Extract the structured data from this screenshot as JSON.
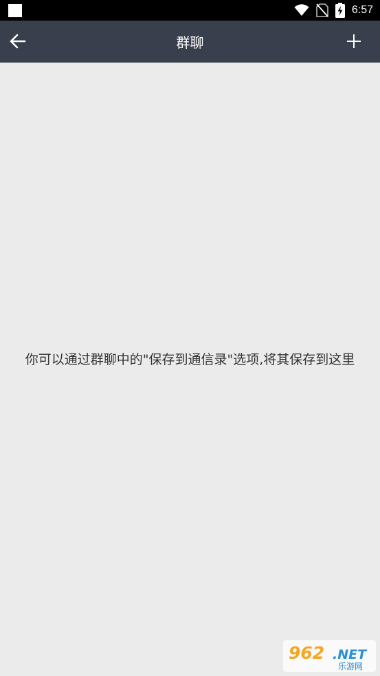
{
  "status_bar": {
    "time": "6:57"
  },
  "app_bar": {
    "title": "群聊"
  },
  "main": {
    "empty_message": "你可以通过群聊中的\"保存到通信录\"选项,将其保存到这里"
  },
  "watermark": {
    "site": "962.NET",
    "subtitle": "乐游网"
  },
  "colors": {
    "app_bar": "#3a3f4d",
    "background": "#ebebeb",
    "status_bar": "#000000",
    "watermark_orange": "#f5a623",
    "watermark_blue": "#2a8fd8"
  }
}
